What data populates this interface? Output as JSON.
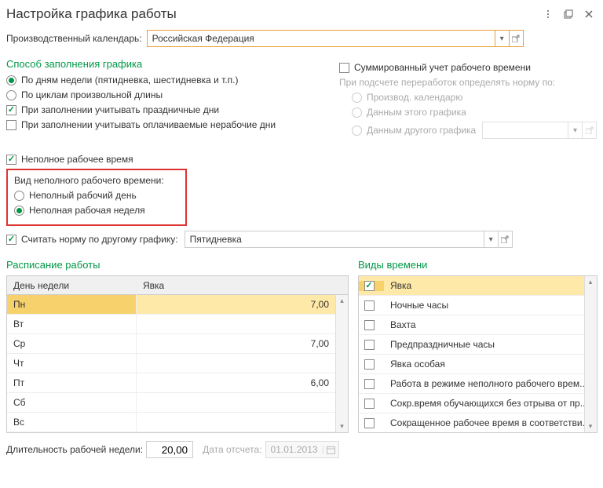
{
  "title": "Настройка графика работы",
  "calendar": {
    "label": "Производственный календарь:",
    "value": "Российская Федерация"
  },
  "fillMethod": {
    "title": "Способ заполнения графика",
    "byWeekDays": "По дням недели (пятидневка, шестидневка и т.п.)",
    "byCycles": "По циклам произвольной длины",
    "considerHolidays": "При заполнении учитывать праздничные дни",
    "considerPaidNonWork": "При заполнении учитывать оплачиваемые нерабочие дни"
  },
  "summarized": {
    "label": "Суммированный учет рабочего времени",
    "subLabel": "При подсчете переработок определять норму по:",
    "byProdCalendar": "Производ. календарю",
    "byThisSchedule": "Данным этого графика",
    "byOtherSchedule": "Данным другого графика"
  },
  "partTime": {
    "checkbox": "Неполное рабочее время",
    "groupTitle": "Вид неполного рабочего времени:",
    "partDay": "Неполный рабочий день",
    "partWeek": "Неполная рабочая неделя",
    "normByOther": "Считать норму по другому графику:",
    "otherSchedule": "Пятидневка"
  },
  "scheduleTable": {
    "title": "Расписание работы",
    "col1": "День недели",
    "col2": "Явка",
    "rows": [
      {
        "day": "Пн",
        "hours": "7,00"
      },
      {
        "day": "Вт",
        "hours": ""
      },
      {
        "day": "Ср",
        "hours": "7,00"
      },
      {
        "day": "Чт",
        "hours": ""
      },
      {
        "day": "Пт",
        "hours": "6,00"
      },
      {
        "day": "Сб",
        "hours": ""
      },
      {
        "day": "Вс",
        "hours": ""
      }
    ]
  },
  "timeTypes": {
    "title": "Виды времени",
    "rows": [
      {
        "name": "Явка",
        "checked": true,
        "sel": true
      },
      {
        "name": "Ночные часы",
        "checked": false
      },
      {
        "name": "Вахта",
        "checked": false
      },
      {
        "name": "Предпраздничные часы",
        "checked": false
      },
      {
        "name": "Явка особая",
        "checked": false
      },
      {
        "name": "Работа в режиме неполного рабочего врем...",
        "checked": false
      },
      {
        "name": "Сокр.время обучающихся без отрыва от пр...",
        "checked": false
      },
      {
        "name": "Сокращенное рабочее время в соответстви...",
        "checked": false
      }
    ]
  },
  "footer": {
    "weekDurationLabel": "Длительность рабочей недели:",
    "weekDuration": "20,00",
    "startDateLabel": "Дата отсчета:",
    "startDate": "01.01.2013"
  }
}
